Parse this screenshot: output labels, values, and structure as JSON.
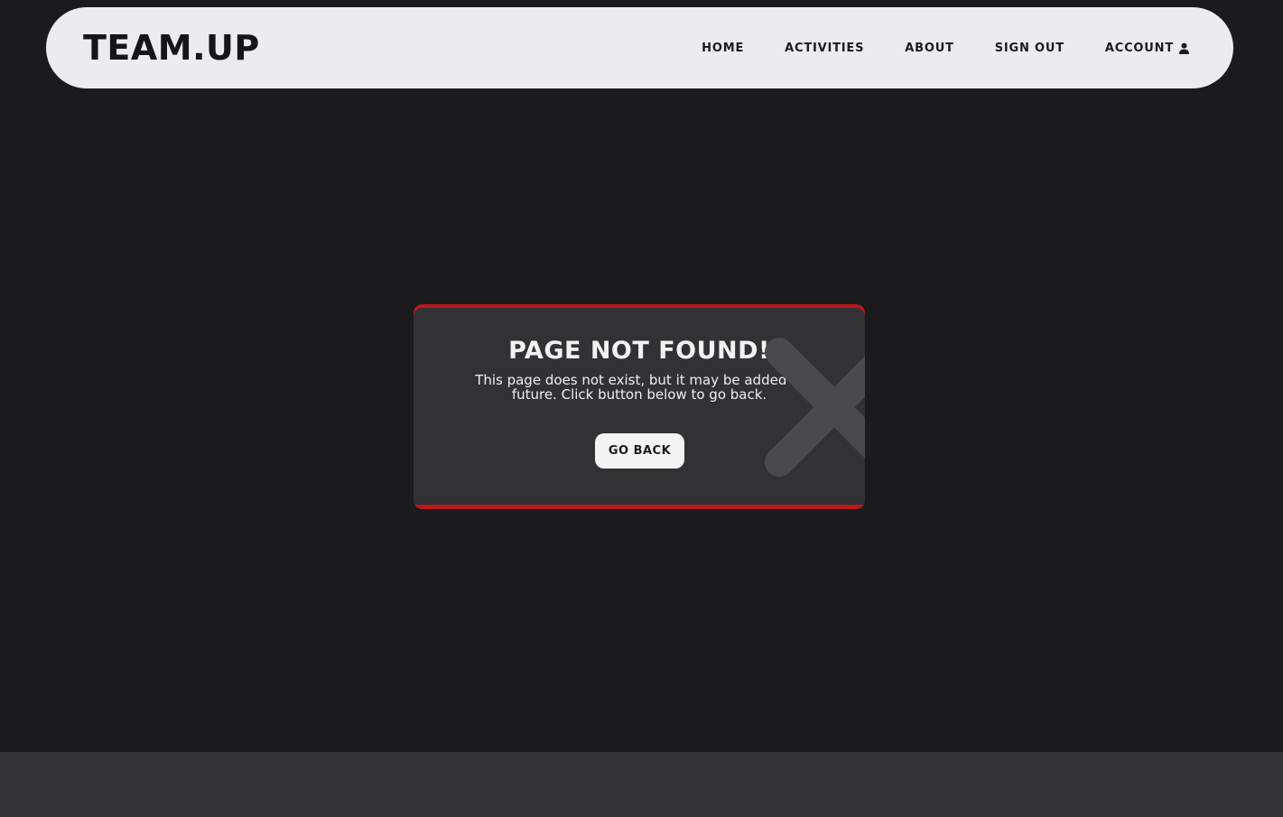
{
  "header": {
    "logo": "TEAM.UP",
    "nav": {
      "home": "HOME",
      "activities": "ACTIVITIES",
      "about": "ABOUT",
      "sign_out": "SIGN OUT",
      "account": "ACCOUNT"
    },
    "account_icon": "user-icon"
  },
  "error_card": {
    "title": "PAGE NOT FOUND!",
    "message": "This page does not exist, but it may be added in future. Click button below to go back.",
    "button_label": "GO BACK",
    "decor_icon": "x-icon"
  },
  "colors": {
    "background": "#1b1a1d",
    "navbar": "#ececee",
    "card": "#323134",
    "accent": "#b7191f",
    "footer": "#323134"
  }
}
